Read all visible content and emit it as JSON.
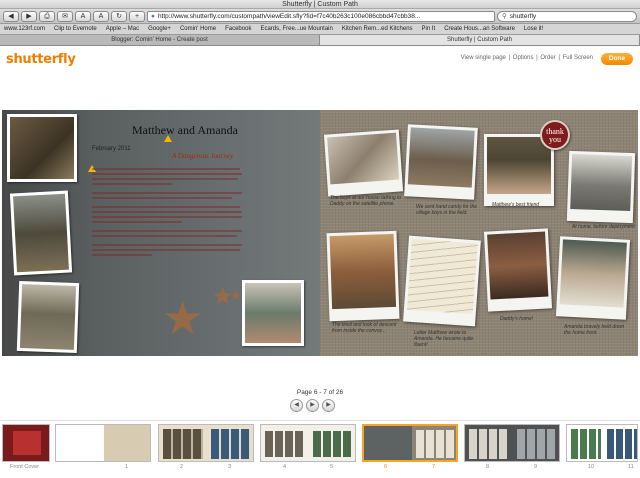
{
  "window": {
    "title": "Shutterfly | Custom Path"
  },
  "toolbar": {
    "back": "◀",
    "forward": "▶",
    "print": "⎙",
    "read": "✉",
    "font_small": "A",
    "font_large": "A",
    "reload": "↻",
    "add": "+",
    "url": "http://www.shutterfly.com/custompath/viewEdit.sfly?fid=f7c40b263c100e086cbbd47cbb38...",
    "search_value": "shutterfly"
  },
  "bookmarks": [
    "www.123rf.com",
    "Clip to Evernote",
    "Apple – Mac",
    "Google+",
    "Comin' Home",
    "Facebook",
    "Ecards, Free...ue Mountain",
    "Kitchen Rem...ed Kitchens",
    "Pin It",
    "Create Hous...an Software",
    "Lose it!"
  ],
  "tabs": [
    {
      "label": "Blogger: Comin' Home - Create post"
    },
    {
      "label": "Shutterfly | Custom Path"
    }
  ],
  "header": {
    "logo": "shutterfly",
    "links": [
      "View single page",
      "Options",
      "Order",
      "Full Screen"
    ],
    "done": "Done"
  },
  "left_page": {
    "title": "Matthew and Amanda",
    "date": "February 2011",
    "subtitle": "A Dangerous Journey"
  },
  "right_page": {
    "badge": "thank you",
    "captions": [
      "The boys at our house talking to Daddy on the satellite phone.",
      "We sent hand candy for the village boys in the field.",
      "Matthew's best friend",
      "At home, before deployment",
      "The tired and look of descent from inside the convoy...",
      "Letter Matthew wrote to Amanda. He became quite fluent!",
      "Daddy's home!",
      "Amanda bravely held down the home front."
    ]
  },
  "pager": {
    "info": "Page 6 - 7 of 26",
    "prev": "◀",
    "play": "▶",
    "next": "▶"
  },
  "filmstrip": {
    "front_label": "Front Cover",
    "page_numbers": [
      "1",
      "2",
      "3",
      "4",
      "5",
      "6",
      "7",
      "8",
      "9",
      "10",
      "11"
    ]
  },
  "colors": {
    "brand_orange": "#f07d00",
    "selected_border": "#f5a623",
    "left_page_bg": "#5a5f60",
    "right_page_bg": "#8e8475",
    "subtitle_red": "#9a2b1b",
    "badge_red": "#7f1b1b"
  }
}
